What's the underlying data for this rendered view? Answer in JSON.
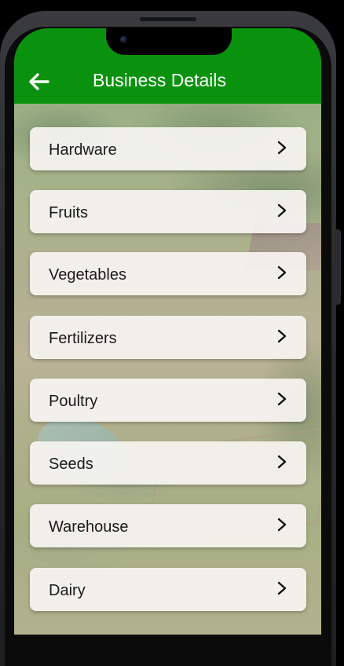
{
  "app_bar": {
    "title": "Business Details",
    "background_color": "#0a920e",
    "back_icon": "arrow-left-icon"
  },
  "categories": [
    {
      "label": "Hardware",
      "icon": "chevron-right-icon"
    },
    {
      "label": "Fruits",
      "icon": "chevron-right-icon"
    },
    {
      "label": "Vegetables",
      "icon": "chevron-right-icon"
    },
    {
      "label": "Fertilizers",
      "icon": "chevron-right-icon"
    },
    {
      "label": "Poultry",
      "icon": "chevron-right-icon"
    },
    {
      "label": "Seeds",
      "icon": "chevron-right-icon"
    },
    {
      "label": "Warehouse",
      "icon": "chevron-right-icon"
    },
    {
      "label": "Dairy",
      "icon": "chevron-right-icon"
    }
  ]
}
